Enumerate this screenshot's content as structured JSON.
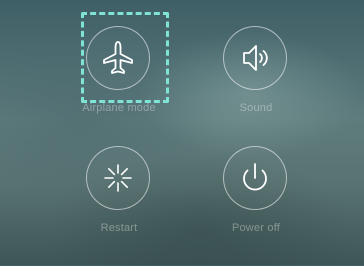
{
  "quick_actions": [
    {
      "id": "airplane",
      "label": "Airplane mode",
      "icon": "airplane-icon"
    },
    {
      "id": "sound",
      "label": "Sound",
      "icon": "speaker-icon"
    },
    {
      "id": "restart",
      "label": "Restart",
      "icon": "restart-icon"
    },
    {
      "id": "poweroff",
      "label": "Power off",
      "icon": "power-icon"
    }
  ],
  "highlight_color": "#7fe3d6"
}
